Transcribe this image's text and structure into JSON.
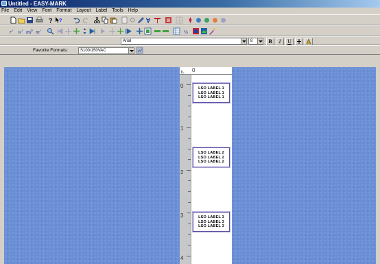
{
  "window": {
    "title": "Untitled - EASY-MARK"
  },
  "menu": [
    "File",
    "Edit",
    "View",
    "Font",
    "Format",
    "Layout",
    "Label",
    "Tools",
    "Help"
  ],
  "font_toolbar": {
    "font_name": "Arial",
    "font_size": "8",
    "bold": "B",
    "italic": "I",
    "underline": "U"
  },
  "favorites": {
    "label": "Favorite Formats:",
    "value": "S100/150VAC"
  },
  "ruler": {
    "h_origin": "0",
    "v_marks": [
      "0",
      "1",
      "2",
      "3",
      "4"
    ]
  },
  "labels": [
    {
      "lines": [
        "LSO LABEL 1",
        "LSO LABEL 1",
        "LSO LABEL 1"
      ]
    },
    {
      "lines": [
        "LSO LABEL 2",
        "LSO LABEL 2",
        "LSO LABEL 2"
      ]
    },
    {
      "lines": [
        "LSO LABEL 3",
        "LSO LABEL 3",
        "LSO LABEL 3"
      ]
    }
  ],
  "colors": {
    "workspace": "#6b8fd6",
    "title_bar": "#0a246a",
    "label_border": "#5b4fa0"
  }
}
